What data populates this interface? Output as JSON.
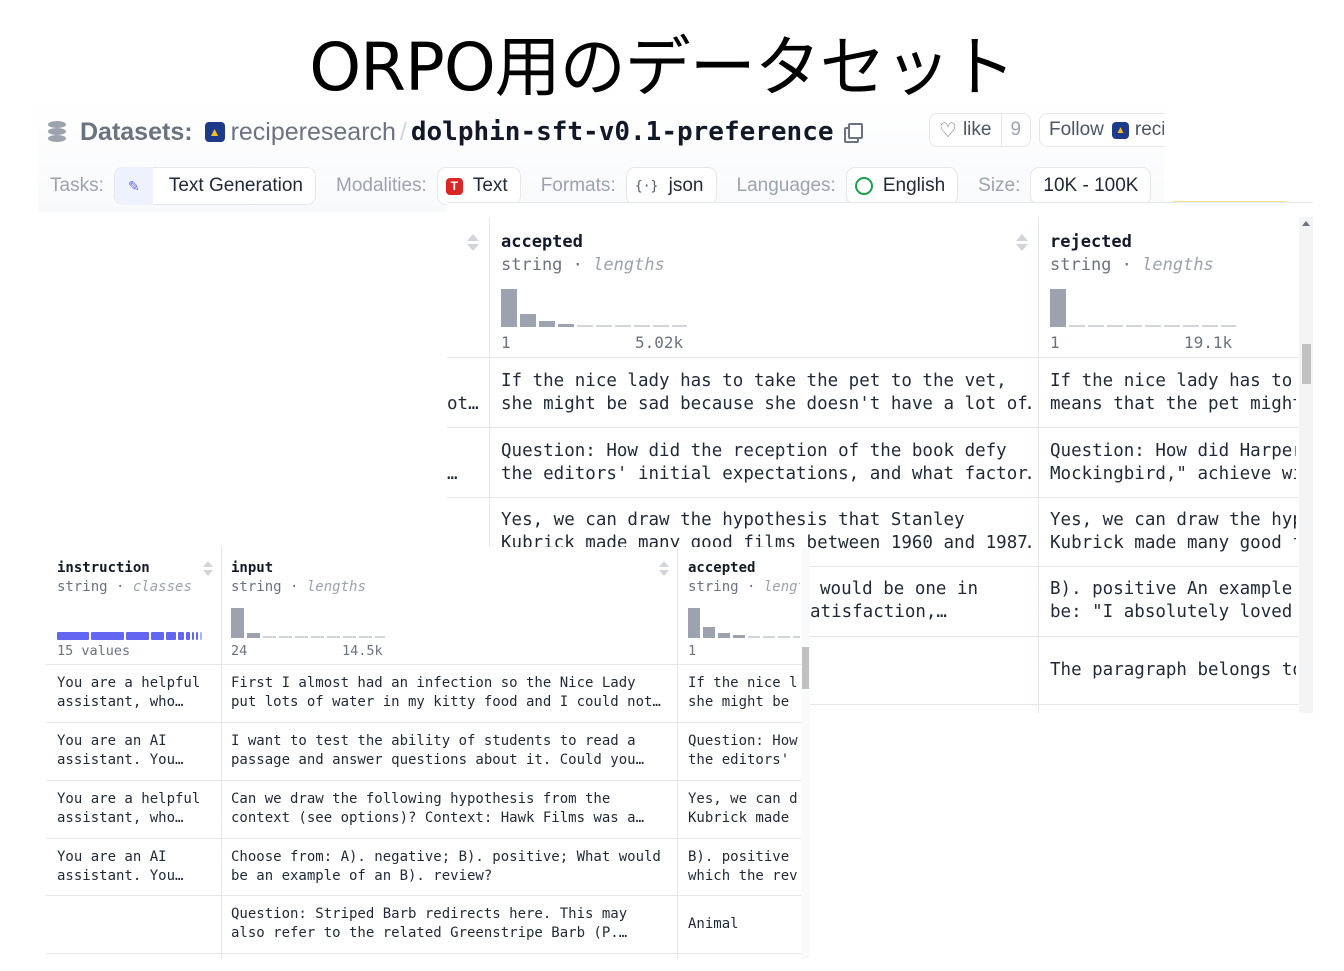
{
  "slide_title": "ORPO用のデータセット",
  "header": {
    "datasets_label": "Datasets:",
    "org": "reciperesearch",
    "separator": "/",
    "repo": "dolphin-sft-v0.1-preference",
    "like_label": "like",
    "like_count": "9",
    "follow_label": "Follow",
    "follow_org": "reci"
  },
  "meta": {
    "tasks_key": "Tasks:",
    "task": "Text Generation",
    "modalities_key": "Modalities:",
    "modality": "Text",
    "formats_key": "Formats:",
    "format": "json",
    "languages_key": "Languages:",
    "language": "English",
    "size_key": "Size:",
    "size": "10K - 100K"
  },
  "right_table": {
    "columns": [
      {
        "name": "accepted",
        "type": "string",
        "stat": "lengths",
        "min": "1",
        "max": "5.02k"
      },
      {
        "name": "rejected",
        "type": "string",
        "stat": "lengths",
        "min": "1",
        "max": "19.1k"
      }
    ],
    "rows": [
      {
        "partial": "ot…",
        "accepted": [
          "If the nice lady has to take the pet to the vet,",
          "she might be sad because she doesn't have a lot of…"
        ],
        "rejected": [
          "If the nice lady has to",
          "means that the pet might"
        ]
      },
      {
        "partial": "…",
        "accepted": [
          "Question: How did the reception of the book defy",
          "the editors' initial expectations, and what factor…"
        ],
        "rejected": [
          "Question: How did Harper",
          "Mockingbird,\" achieve wi"
        ]
      },
      {
        "partial": "",
        "accepted": [
          "Yes, we can draw the hypothesis that Stanley",
          "Kubrick made many good films between 1960 and 1987…"
        ],
        "rejected": [
          "Yes, we can draw the hyp",
          "Kubrick made many good f"
        ]
      },
      {
        "partial": "",
        "accepted": [
          "would be one in",
          "atisfaction,…"
        ],
        "rejected": [
          "B). positive An example",
          "be: \"I absolutely loved"
        ]
      },
      {
        "partial": "",
        "accepted": [
          ""
        ],
        "rejected": [
          "The paragraph belongs to"
        ]
      }
    ]
  },
  "left_table": {
    "columns": [
      {
        "name": "instruction",
        "type": "string",
        "stat": "classes",
        "summary": "15 values"
      },
      {
        "name": "input",
        "type": "string",
        "stat": "lengths",
        "min": "24",
        "max": "14.5k"
      },
      {
        "name": "accepted",
        "type": "string",
        "stat": "lengt",
        "min": "1"
      }
    ],
    "rows": [
      {
        "instruction": [
          "You are a helpful",
          "assistant, who…"
        ],
        "input": [
          "First I almost had an infection so the Nice Lady",
          "put lots of water in my kitty food and I could not…"
        ],
        "accepted": [
          "If the nice l",
          "she might be "
        ]
      },
      {
        "instruction": [
          "You are an AI",
          "assistant. You…"
        ],
        "input": [
          "I want to test the ability of students to read a",
          "passage and answer questions about it. Could you…"
        ],
        "accepted": [
          "Question: How",
          "the editors' "
        ]
      },
      {
        "instruction": [
          "You are a helpful",
          "assistant, who…"
        ],
        "input": [
          "Can we draw the following hypothesis from the",
          "context (see options)? Context: Hawk Films was a…"
        ],
        "accepted": [
          "Yes, we can d",
          "Kubrick made "
        ]
      },
      {
        "instruction": [
          "You are an AI",
          "assistant. You…"
        ],
        "input": [
          "Choose from: A). negative; B). positive; What would",
          "be an example of an B). review?"
        ],
        "accepted": [
          "B). positive ",
          "which the rev"
        ]
      },
      {
        "instruction": [
          "",
          ""
        ],
        "input": [
          "Question: Striped Barb redirects here. This may",
          "also refer to the related Greenstripe Barb (P.…"
        ],
        "accepted": [
          "Animal",
          ""
        ]
      }
    ]
  }
}
